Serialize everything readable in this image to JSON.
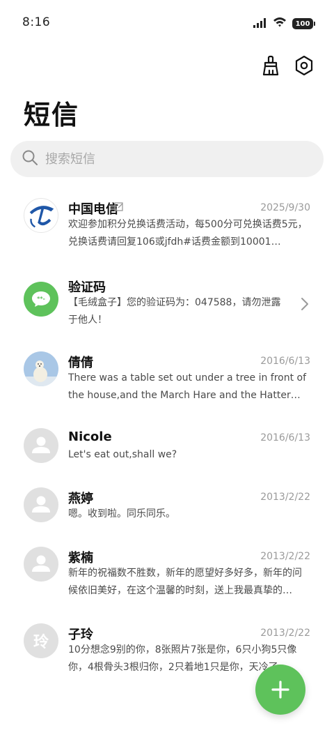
{
  "status_bar": {
    "time": "8:16",
    "battery": "100",
    "icons": [
      "signal-icon",
      "wifi-icon",
      "battery-icon"
    ]
  },
  "toolbar": {
    "icons": [
      "broom-icon",
      "settings-icon"
    ]
  },
  "page": {
    "title": "短信"
  },
  "search": {
    "placeholder": "搜索短信",
    "value": ""
  },
  "conversations": [
    {
      "name": "中国电信",
      "date": "2025/9/30",
      "preview": "欢迎参加积分兑换话费活动，每500分可兑换话费5元，兑换话费请回复106或jfdh#话费金额到10001…",
      "avatar": "china-telecom-logo"
    },
    {
      "name": "验证码",
      "date": "",
      "preview": "【毛绒盒子】您的验证码为：047588，请勿泄露于他人！",
      "avatar": "message-bubble-icon"
    },
    {
      "name": "倩倩",
      "date": "2016/6/13",
      "preview": "There was a table set out under a tree in front of the house,and the March Hare and the Hatter we…",
      "avatar": "polar-bear-photo"
    },
    {
      "name": "Nicole",
      "date": "2016/6/13",
      "preview": "Let's eat out,shall we?",
      "avatar": "person-icon"
    },
    {
      "name": "燕婷",
      "date": "2013/2/22",
      "preview": "嗯。收到啦。同乐同乐。",
      "avatar": "person-icon"
    },
    {
      "name": "紫楠",
      "date": "2013/2/22",
      "preview": "新年的祝福数不胜数，新年的愿望好多好多，新年的问候依旧美好，在这个温馨的时刻，送上我最真挚的…",
      "avatar": "person-icon"
    },
    {
      "name": "子玲",
      "date": "2013/2/22",
      "preview": "10分想念9别的你，8张照片7张是你，6只小狗5只像你，4根骨头3根归你，2只着地1只是你，天冷了…",
      "avatar": "玲"
    }
  ],
  "colors": {
    "accent": "#5ec25b",
    "telecom_blue": "#1f57a8",
    "gray_avatar": "#e0e0e0",
    "search_bg": "#f0f0f0"
  }
}
